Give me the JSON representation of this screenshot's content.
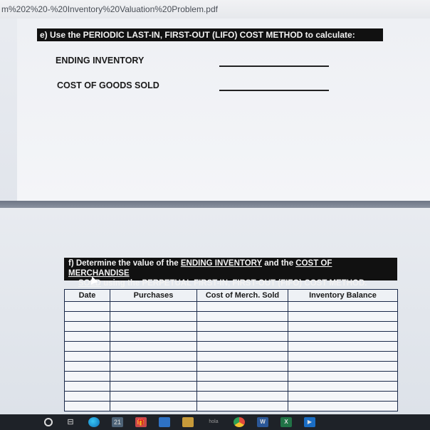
{
  "browser": {
    "url_fragment": "m%202%20-%20Inventory%20Valuation%20Problem.pdf"
  },
  "section_e": {
    "heading": "e)  Use the PERIODIC LAST-IN, FIRST-OUT (LIFO) COST METHOD to calculate:",
    "ending_inventory_label": "ENDING INVENTORY",
    "cogs_label": "COST OF GOODS SOLD"
  },
  "section_f": {
    "line1_prefix": "f)  Determine the value of the ",
    "line1_ending": "ENDING INVENTORY",
    "line1_mid": " and the ",
    "line1_cost": "COST OF MERCHANDISE",
    "line2_sold": "SOLD",
    "line2_rest": " using the PERPETUAL FIRST-IN, FIRST-OUT (FIFO) COST METHOD.",
    "table": {
      "headers": [
        "Date",
        "Purchases",
        "Cost of Merch. Sold",
        "Inventory Balance"
      ]
    }
  },
  "taskbar": {
    "task_view_glyph": "⊟",
    "store_glyph": "21",
    "gift_glyph": "🎁",
    "hola_label": "hola",
    "word_label": "W",
    "excel_label": "X",
    "media_glyph": "▶"
  },
  "colors": {
    "banner_bg": "#111111",
    "table_border": "#1b2a4a",
    "taskbar_bg": "#1e2228"
  }
}
